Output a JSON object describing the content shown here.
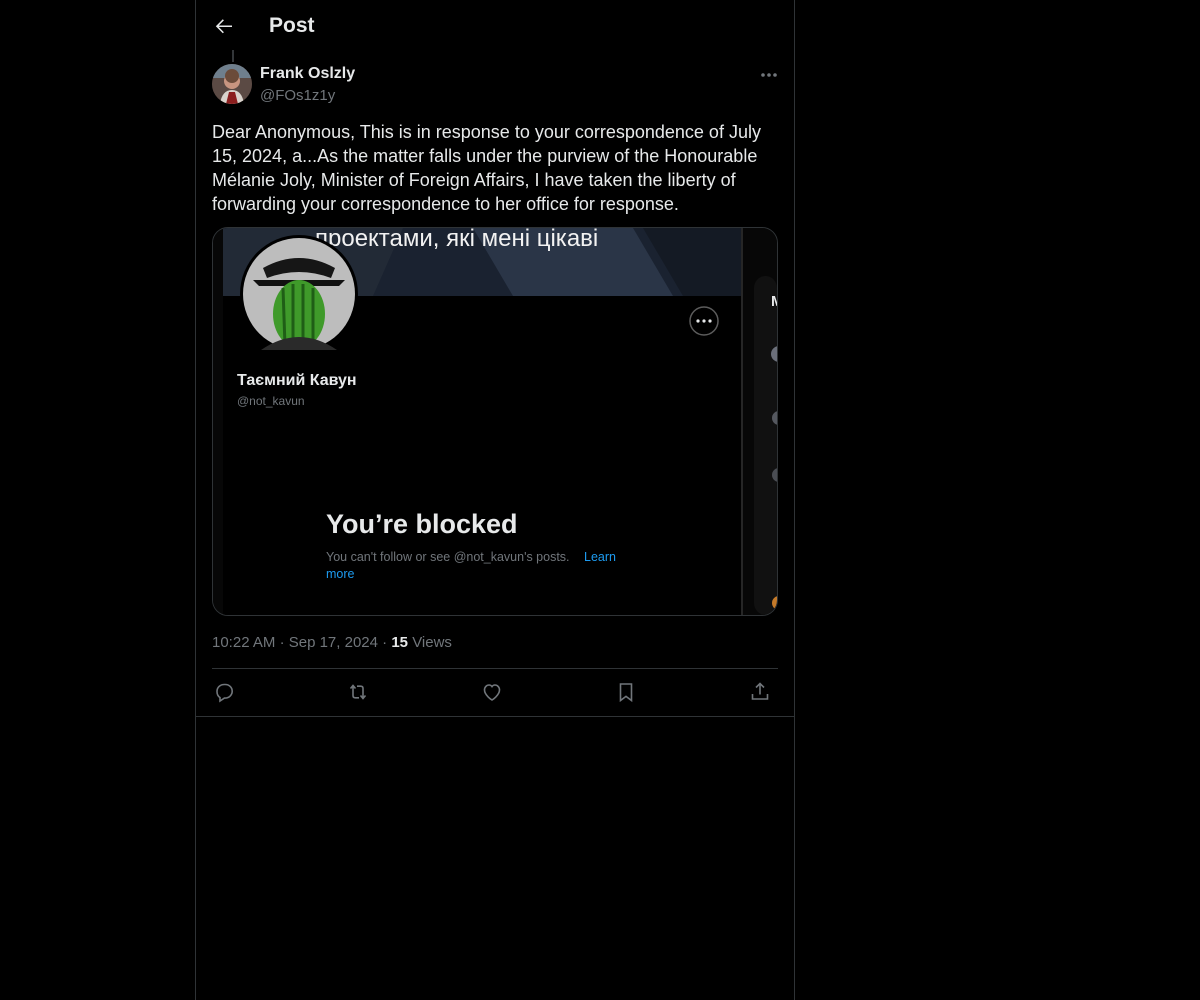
{
  "header": {
    "title": "Post",
    "back_icon": "arrow-left-icon"
  },
  "post": {
    "author_name": "Frank Oslzly",
    "author_handle": "@FOs1z1y",
    "text_lines": [
      "Dear Anonymous,  This is in response to your correspondence of July",
      "15, 2024, a...As the matter falls under the purview of the  Honourable",
      "Mélanie Joly, Minister of Foreign Affairs, I have taken the  liberty of",
      "forwarding your correspondence to her office for response."
    ],
    "time": "10:22 AM",
    "date": "Sep 17, 2024",
    "views_count": "15",
    "views_label": "Views",
    "separator": "·"
  },
  "media": {
    "banner_text": "проектами, які мені цікаві",
    "profile_name": "Таємний Кавун",
    "profile_handle": "@not_kavun",
    "blocked_title": "You’re blocked",
    "blocked_message": "You can't follow or see @not_kavun's posts.",
    "learn_more_1": "Learn",
    "learn_more_2": "more",
    "side_letter": "M"
  },
  "actions": [
    {
      "name": "reply",
      "icon": "reply-icon"
    },
    {
      "name": "repost",
      "icon": "repost-icon"
    },
    {
      "name": "like",
      "icon": "heart-icon"
    },
    {
      "name": "bookmark",
      "icon": "bookmark-icon"
    },
    {
      "name": "share",
      "icon": "share-icon"
    }
  ],
  "colors": {
    "background": "#000000",
    "text": "#e7e9ea",
    "muted": "#71767b",
    "border": "#2f3336",
    "link": "#1d9bf0"
  }
}
